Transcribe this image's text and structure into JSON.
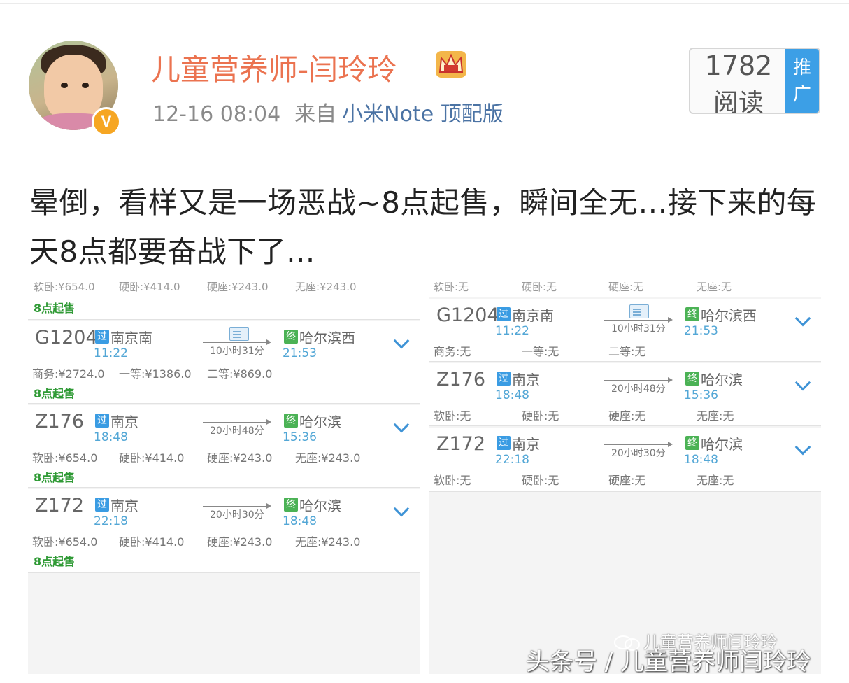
{
  "post": {
    "username": "儿童营养师-闫玲玲",
    "timestamp": "12-16 08:04",
    "source_prefix": "来自",
    "device": "小米Note 顶配版",
    "read_count": "1782",
    "read_label": "阅读",
    "promote_label": "推广",
    "verified_mark": "V",
    "text": "晕倒，看样又是一场恶战~8点起售，瞬间全无…接下来的每天8点都要奋战下了..."
  },
  "left_screen": {
    "top_partial": [
      "软卧:¥654.0",
      "硬卧:¥414.0",
      "硬座:¥243.0",
      "无座:¥243.0"
    ],
    "top_sale": "8点起售",
    "trains": [
      {
        "number": "G1204",
        "from_tag": "过",
        "from": "南京南",
        "depart": "11:22",
        "duration": "10小时31分",
        "to_tag": "终",
        "to": "哈尔滨西",
        "arrive": "21:53",
        "prices": [
          "商务:¥2724.0",
          "一等:¥1386.0",
          "二等:¥869.0"
        ],
        "sale": "8点起售"
      },
      {
        "number": "Z176",
        "from_tag": "过",
        "from": "南京",
        "depart": "18:48",
        "duration": "20小时48分",
        "to_tag": "终",
        "to": "哈尔滨",
        "arrive": "15:36",
        "prices": [
          "软卧:¥654.0",
          "硬卧:¥414.0",
          "硬座:¥243.0",
          "无座:¥243.0"
        ],
        "sale": "8点起售"
      },
      {
        "number": "Z172",
        "from_tag": "过",
        "from": "南京",
        "depart": "22:18",
        "duration": "20小时30分",
        "to_tag": "终",
        "to": "哈尔滨",
        "arrive": "18:48",
        "prices": [
          "软卧:¥654.0",
          "硬卧:¥414.0",
          "硬座:¥243.0",
          "无座:¥243.0"
        ],
        "sale": "8点起售"
      }
    ]
  },
  "right_screen": {
    "top_partial": [
      "软卧:无",
      "硬卧:无",
      "硬座:无",
      "无座:无"
    ],
    "trains": [
      {
        "number": "G1204",
        "from_tag": "过",
        "from": "南京南",
        "depart": "11:22",
        "duration": "10小时31分",
        "to_tag": "终",
        "to": "哈尔滨西",
        "arrive": "21:53",
        "prices": [
          "商务:无",
          "一等:无",
          "二等:无"
        ]
      },
      {
        "number": "Z176",
        "from_tag": "过",
        "from": "南京",
        "depart": "18:48",
        "duration": "20小时48分",
        "to_tag": "终",
        "to": "哈尔滨",
        "arrive": "15:36",
        "prices": [
          "软卧:无",
          "硬卧:无",
          "硬座:无",
          "无座:无"
        ]
      },
      {
        "number": "Z172",
        "from_tag": "过",
        "from": "南京",
        "depart": "22:18",
        "duration": "20小时30分",
        "to_tag": "终",
        "to": "哈尔滨",
        "arrive": "18:48",
        "prices": [
          "软卧:无",
          "硬卧:无",
          "硬座:无",
          "无座:无"
        ]
      }
    ]
  },
  "watermark": {
    "text": "头条号 / 儿童营养师闫玲玲",
    "account": "儿童营养师闫玲玲"
  },
  "icons": {
    "crown": "crown-icon",
    "verified": "verified-badge-icon",
    "expand": "chevron-down-icon",
    "id_card": "id-card-icon"
  },
  "colors": {
    "username": "#eb7350",
    "device_link": "#4b73a4",
    "promote": "#3c9fe6",
    "verified": "#f6a623",
    "sale": "#2f9a35",
    "time": "#53a7d6"
  }
}
